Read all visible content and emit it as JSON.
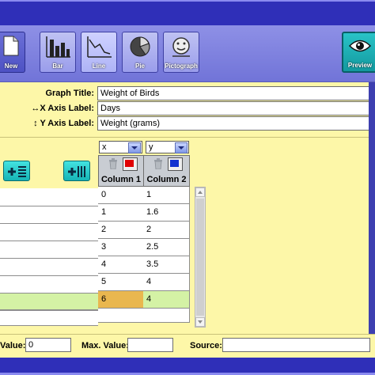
{
  "toolbar": {
    "new_label": "New",
    "bar_label": "Bar",
    "line_label": "Line",
    "pie_label": "Pie",
    "pictograph_label": "Pictograph",
    "preview_label": "Preview"
  },
  "form": {
    "title_label": "Graph Title:",
    "title_value": "Weight of Birds",
    "xlabel_label": "X Axis Label:",
    "xlabel_value": "Days",
    "ylabel_label": "Y Axis Label:",
    "ylabel_value": "Weight (grams)",
    "xlabel_icon": "horizontal-arrow-icon",
    "ylabel_icon": "vertical-arrow-icon"
  },
  "table": {
    "col1": {
      "axis": "x",
      "header": "Column 1",
      "color": "#e00000"
    },
    "col2": {
      "axis": "y",
      "header": "Column 2",
      "color": "#1030d0"
    },
    "rows": [
      [
        "0",
        "1"
      ],
      [
        "1",
        "1.6"
      ],
      [
        "2",
        "2"
      ],
      [
        "3",
        "2.5"
      ],
      [
        "4",
        "3.5"
      ],
      [
        "5",
        "4"
      ],
      [
        "6",
        "4"
      ],
      [
        "",
        ""
      ]
    ]
  },
  "bottom": {
    "min_label": "Value:",
    "min_value": "0",
    "max_label": "Max. Value:",
    "max_value": "",
    "source_label": "Source:",
    "source_value": ""
  },
  "colors": {
    "toolbar": "#7f82e0",
    "panel": "#fdf7a8",
    "frame": "#2f2fb8",
    "highlight_row": "#d4f2a5",
    "editing_cell": "#e9b74f"
  }
}
